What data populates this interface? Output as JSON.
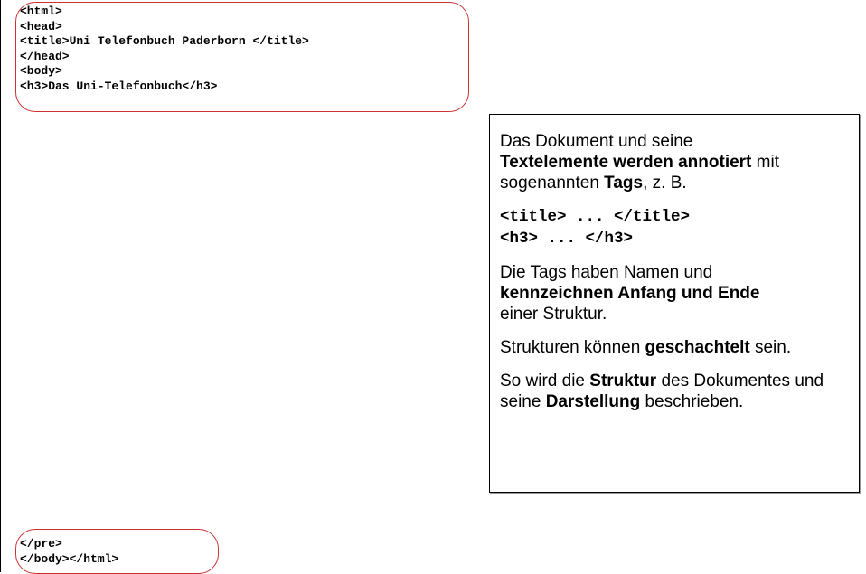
{
  "code_top": {
    "lines": [
      "<html>",
      "<head>",
      "<title>Uni Telefonbuch Paderborn </title>",
      "</head>",
      "<body>",
      "<h3>Das Uni-Telefonbuch</h3>"
    ]
  },
  "code_bottom": {
    "lines": [
      "</pre>",
      "</body></html>"
    ]
  },
  "note": {
    "p1": {
      "t1": "Das Dokument und seine",
      "b1": "Textelemente werden annotiert",
      "t2": " mit sogenannten ",
      "b2": "Tags",
      "t3": ", z. B."
    },
    "code": [
      "<title> ... </title>",
      "<h3> ... </h3>"
    ],
    "p2": {
      "t1": "Die Tags haben Namen und",
      "b1": "kennzeichnen Anfang und Ende",
      "t2": "einer Struktur."
    },
    "p3": {
      "t1": "Strukturen können ",
      "b1": "geschachtelt",
      "t2": " sein."
    },
    "p4": {
      "t1": "So wird die ",
      "b1": "Struktur",
      "t2": " des Dokumentes und seine ",
      "b2": "Darstellung",
      "t3": " beschrieben."
    }
  }
}
